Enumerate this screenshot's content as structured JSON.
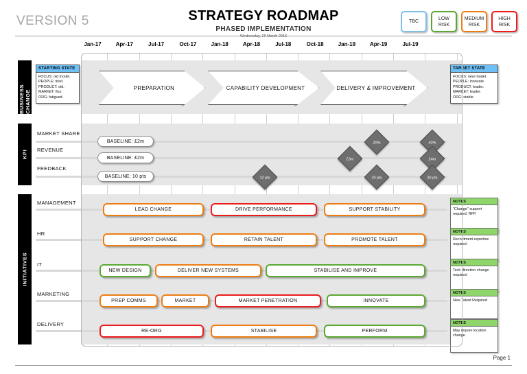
{
  "header": {
    "version": "VERSION 5",
    "title": "STRATEGY ROADMAP",
    "subtitle": "PHASED IMPLEMENTATION",
    "date": "Wednesday, 16 March 2016"
  },
  "legend": [
    {
      "label": "TBC",
      "color": "#7ec0ea"
    },
    {
      "label": "LOW\nRISK",
      "color": "#5aa832"
    },
    {
      "label": "MEDIUM\nRISK",
      "color": "#ee7d11"
    },
    {
      "label": "HIGH\nRISK",
      "color": "#ec1c1c"
    }
  ],
  "legend_labels": {
    "tbc": "TBC",
    "low_risk_l1": "LOW",
    "low_risk_l2": "RISK",
    "medium_risk_l1": "MEDIUM",
    "medium_risk_l2": "RISK",
    "high_risk_l1": "HIGH",
    "high_risk_l2": "RISK"
  },
  "timeline": {
    "labels": [
      "Jan-17",
      "Apr-17",
      "Jul-17",
      "Oct-17",
      "Jan-18",
      "Apr-18",
      "Jul-18",
      "Oct-18",
      "Jan-19",
      "Apr-19",
      "Jul-19"
    ]
  },
  "bands": {
    "business_change": "BUSINESS CHANGE",
    "kpi": "KPI",
    "initiatives": "INITIATIVES"
  },
  "starting_state": {
    "title": "STARTING STATE",
    "lines": [
      "FOCUS: old model.",
      "PEOPLE: tired.",
      "PRODUCT: old.",
      "MARKET: flux.",
      "ORG: fatigued."
    ]
  },
  "target_state": {
    "title": "TARGET STATE",
    "lines": [
      "FOCUS: new  model.",
      "PEOPLE: innovate.",
      "PRODUCT: leader.",
      "MARKET: leader.",
      "ORG: stable."
    ]
  },
  "phases": [
    {
      "label": "PREPARATION"
    },
    {
      "label": "CAPABILITY DEVELOPMENT"
    },
    {
      "label": "DELIVERY & IMPROVEMENT"
    }
  ],
  "kpi_rows": [
    {
      "label": "MARKET SHARE",
      "baseline": "BASELINE: £2m"
    },
    {
      "label": "REVENUE",
      "baseline": "BASELINE: £2m"
    },
    {
      "label": "FEEDBACK",
      "baseline": "BASELINE: 10 pts"
    }
  ],
  "kpi_markers": [
    {
      "row": "MARKET SHARE",
      "value": "20%"
    },
    {
      "row": "MARKET SHARE",
      "value": "40%"
    },
    {
      "row": "REVENUE",
      "value": "£3m"
    },
    {
      "row": "REVENUE",
      "value": "£4m"
    },
    {
      "row": "FEEDBACK",
      "value": "12 pts"
    },
    {
      "row": "FEEDBACK",
      "value": "20 pts"
    },
    {
      "row": "FEEDBACK",
      "value": "30 pts"
    }
  ],
  "initiative_rows": [
    {
      "label": "MANAGEMENT",
      "bars": [
        {
          "text": "LEAD CHANGE",
          "risk": "medium"
        },
        {
          "text": "DRIVE PERFORMANCE",
          "risk": "high"
        },
        {
          "text": "SUPPORT STABILITY",
          "risk": "medium"
        }
      ],
      "note_title": "NOTES",
      "note_text": "\"Change\" support required. RFP."
    },
    {
      "label": "HR",
      "bars": [
        {
          "text": "SUPPORT CHANGE",
          "risk": "medium"
        },
        {
          "text": "RETAIN TALENT",
          "risk": "medium"
        },
        {
          "text": "PROMOTE TALENT",
          "risk": "medium"
        }
      ],
      "note_title": "NOTES",
      "note_text": "Recruitment expertise required."
    },
    {
      "label": "IT",
      "bars": [
        {
          "text": "NEW DESIGN",
          "risk": "low"
        },
        {
          "text": "DELIVER NEW SYSTEMS",
          "risk": "medium"
        },
        {
          "text": "STABILISE AND IMPROVE",
          "risk": "low"
        }
      ],
      "note_title": "NOTES",
      "note_text": "Tech direction change required."
    },
    {
      "label": "MARKETING",
      "bars": [
        {
          "text": "PREP COMMS",
          "risk": "medium"
        },
        {
          "text": "MARKET",
          "risk": "medium"
        },
        {
          "text": "MARKET PENETRATION",
          "risk": "high"
        },
        {
          "text": "INNOVATE",
          "risk": "low"
        }
      ],
      "note_title": "NOTES",
      "note_text": "New Talent Required"
    },
    {
      "label": "DELIVERY",
      "bars": [
        {
          "text": "RE-ORG",
          "risk": "high"
        },
        {
          "text": "STABILISE",
          "risk": "medium"
        },
        {
          "text": "PERFORM",
          "risk": "low"
        }
      ],
      "note_title": "NOTES",
      "note_text": "May require location change."
    }
  ],
  "footer": {
    "page": "Page 1"
  }
}
